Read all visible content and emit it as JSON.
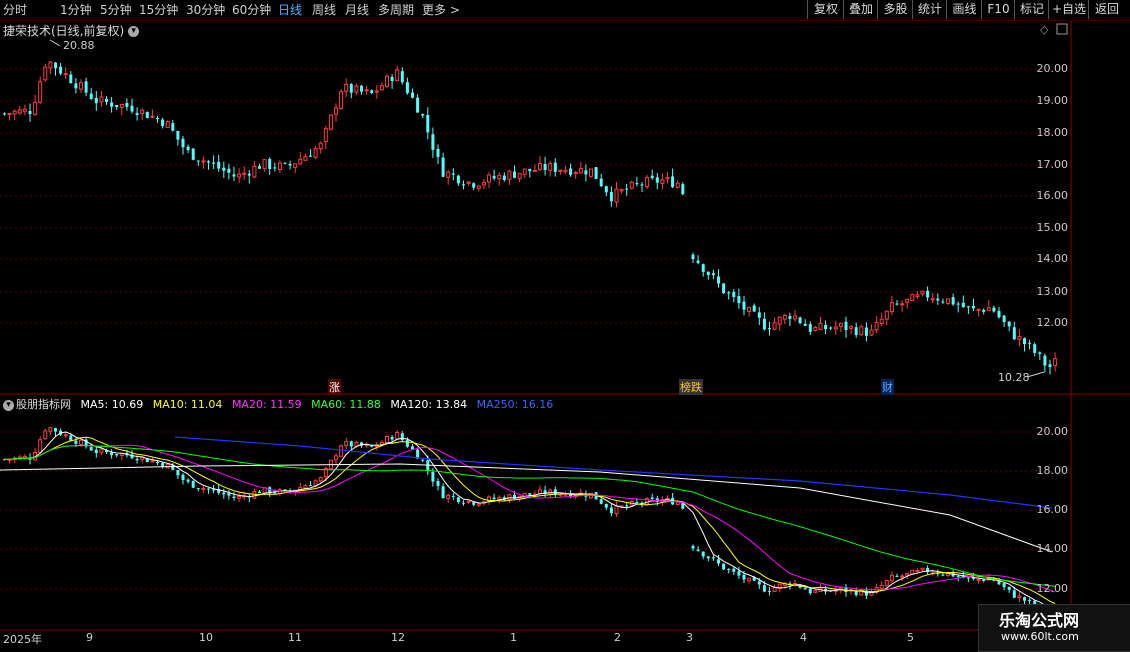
{
  "toolbar": {
    "periods": [
      "分时",
      "1分钟",
      "5分钟",
      "15分钟",
      "30分钟",
      "60分钟",
      "日线",
      "周线",
      "月线",
      "多周期",
      "更多 >"
    ],
    "active_period": "日线",
    "right_buttons": [
      "复权",
      "叠加",
      "多股",
      "统计",
      "画线",
      "F10",
      "标记",
      "+自选",
      "返回"
    ]
  },
  "stock": {
    "title": "捷荣技术(日线,前复权)",
    "high_marker": "20.88",
    "low_marker": "10.28"
  },
  "price_axis": [
    "20.00",
    "19.00",
    "18.00",
    "17.00",
    "16.00",
    "15.00",
    "14.00",
    "13.00",
    "12.00"
  ],
  "indicator": {
    "name": "股朋指标网",
    "ma5": "MA5: 10.69",
    "ma10": "MA10: 11.04",
    "ma20": "MA20: 11.59",
    "ma60": "MA60: 11.88",
    "ma120": "MA120: 13.84",
    "ma250": "MA250: 16.16",
    "axis": [
      "20.00",
      "18.00",
      "16.00",
      "14.00",
      "12.00"
    ]
  },
  "events": [
    "涨",
    "榜跌",
    "财"
  ],
  "time_axis": [
    "2025年",
    "9",
    "10",
    "11",
    "12",
    "1",
    "2",
    "3",
    "4",
    "5"
  ],
  "watermark": {
    "line1": "乐淘公式网",
    "line2": "www.60lt.com"
  },
  "colors": {
    "up": "#ff3c3c",
    "down": "#54ffff",
    "ma5": "#ffffff",
    "ma10": "#ffff00",
    "ma20": "#ff00ff",
    "ma60": "#00ff00",
    "ma120": "#ffffff",
    "ma250": "#0000ff",
    "grid": "#5a0000"
  }
}
